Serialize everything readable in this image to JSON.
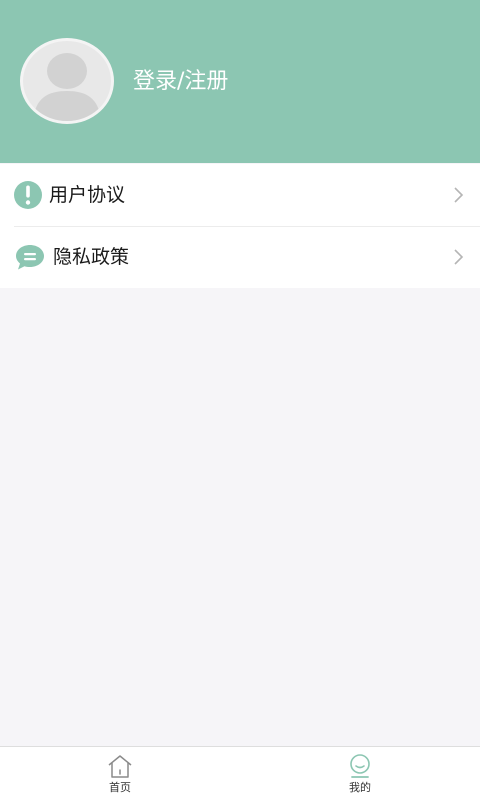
{
  "profile": {
    "login_label": "登录/注册"
  },
  "menu": {
    "items": [
      {
        "label": "用户协议",
        "icon": "exclamation-circle-icon"
      },
      {
        "label": "隐私政策",
        "icon": "chat-bubble-icon"
      }
    ]
  },
  "tabbar": {
    "items": [
      {
        "label": "首页",
        "icon": "home-icon",
        "active": false
      },
      {
        "label": "我的",
        "icon": "profile-face-icon",
        "active": true
      }
    ]
  },
  "colors": {
    "accent": "#8cc6b2",
    "header_bg": "#8cc6b2",
    "page_bg": "#f6f5f8",
    "avatar_bg": "#e8e8e8",
    "avatar_figure": "#d2d2d2",
    "tab_inactive_icon": "#8a8a8a"
  }
}
